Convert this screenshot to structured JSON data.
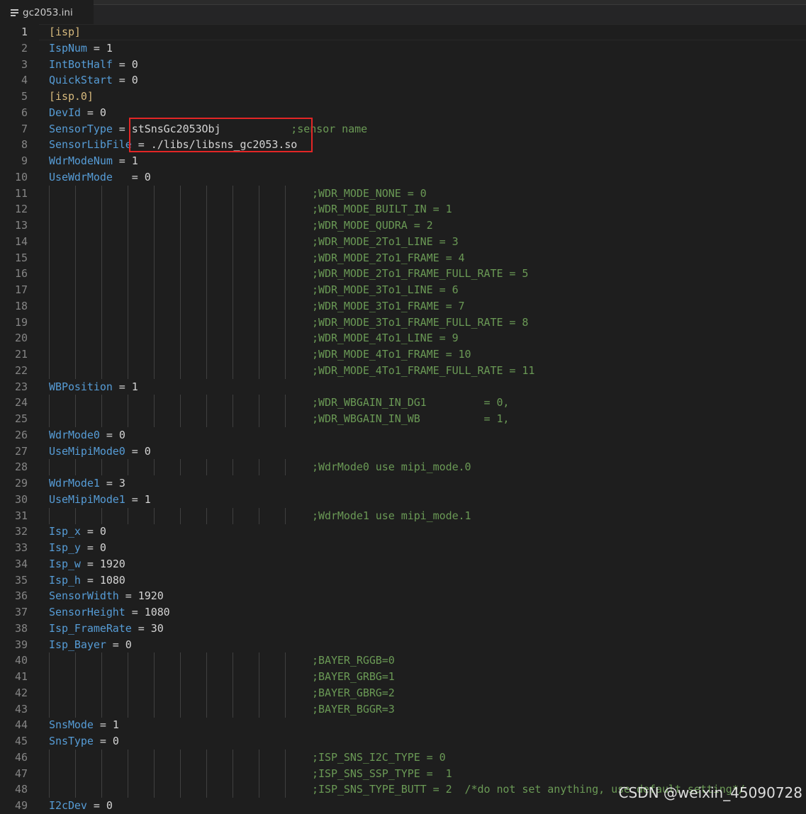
{
  "tab": {
    "filename": "gc2053.ini",
    "icon": "file-lines-icon"
  },
  "lines": [
    {
      "n": "1",
      "parts": [
        {
          "t": "[isp]",
          "c": "sec"
        }
      ],
      "guides": false
    },
    {
      "n": "2",
      "parts": [
        {
          "t": "IspNum",
          "c": "key"
        },
        {
          "t": " = ",
          "c": "eq"
        },
        {
          "t": "1",
          "c": "val"
        }
      ],
      "guides": false
    },
    {
      "n": "3",
      "parts": [
        {
          "t": "IntBotHalf",
          "c": "key"
        },
        {
          "t": " = ",
          "c": "eq"
        },
        {
          "t": "0",
          "c": "val"
        }
      ],
      "guides": false
    },
    {
      "n": "4",
      "parts": [
        {
          "t": "QuickStart",
          "c": "key"
        },
        {
          "t": " = ",
          "c": "eq"
        },
        {
          "t": "0",
          "c": "val"
        }
      ],
      "guides": false
    },
    {
      "n": "5",
      "parts": [
        {
          "t": "[isp.0]",
          "c": "sec"
        }
      ],
      "guides": false
    },
    {
      "n": "6",
      "parts": [
        {
          "t": "DevId",
          "c": "key"
        },
        {
          "t": " = ",
          "c": "eq"
        },
        {
          "t": "0",
          "c": "val"
        }
      ],
      "guides": false
    },
    {
      "n": "7",
      "parts": [
        {
          "t": "SensorType",
          "c": "key"
        },
        {
          "t": " = ",
          "c": "eq"
        },
        {
          "t": "stSnsGc2053Obj           ",
          "c": "val"
        },
        {
          "t": ";sensor name",
          "c": "cmt"
        }
      ],
      "guides": false
    },
    {
      "n": "8",
      "parts": [
        {
          "t": "SensorLibFile",
          "c": "key"
        },
        {
          "t": " = ",
          "c": "eq"
        },
        {
          "t": "./libs/libsns_gc2053.so",
          "c": "val"
        }
      ],
      "guides": false
    },
    {
      "n": "9",
      "parts": [
        {
          "t": "WdrModeNum",
          "c": "key"
        },
        {
          "t": " = ",
          "c": "eq"
        },
        {
          "t": "1",
          "c": "val"
        }
      ],
      "guides": false
    },
    {
      "n": "10",
      "parts": [
        {
          "t": "UseWdrMode",
          "c": "key"
        },
        {
          "t": "   = ",
          "c": "eq"
        },
        {
          "t": "0",
          "c": "val"
        }
      ],
      "guides": false
    },
    {
      "n": "11",
      "parts": [
        {
          "t": ";WDR_MODE_NONE = 0",
          "c": "cmt"
        }
      ],
      "guides": true
    },
    {
      "n": "12",
      "parts": [
        {
          "t": ";WDR_MODE_BUILT_IN = 1",
          "c": "cmt"
        }
      ],
      "guides": true
    },
    {
      "n": "13",
      "parts": [
        {
          "t": ";WDR_MODE_QUDRA = 2",
          "c": "cmt"
        }
      ],
      "guides": true
    },
    {
      "n": "14",
      "parts": [
        {
          "t": ";WDR_MODE_2To1_LINE = 3",
          "c": "cmt"
        }
      ],
      "guides": true
    },
    {
      "n": "15",
      "parts": [
        {
          "t": ";WDR_MODE_2To1_FRAME = 4",
          "c": "cmt"
        }
      ],
      "guides": true
    },
    {
      "n": "16",
      "parts": [
        {
          "t": ";WDR_MODE_2To1_FRAME_FULL_RATE = 5",
          "c": "cmt"
        }
      ],
      "guides": true
    },
    {
      "n": "17",
      "parts": [
        {
          "t": ";WDR_MODE_3To1_LINE = 6",
          "c": "cmt"
        }
      ],
      "guides": true
    },
    {
      "n": "18",
      "parts": [
        {
          "t": ";WDR_MODE_3To1_FRAME = 7",
          "c": "cmt"
        }
      ],
      "guides": true
    },
    {
      "n": "19",
      "parts": [
        {
          "t": ";WDR_MODE_3To1_FRAME_FULL_RATE = 8",
          "c": "cmt"
        }
      ],
      "guides": true
    },
    {
      "n": "20",
      "parts": [
        {
          "t": ";WDR_MODE_4To1_LINE = 9",
          "c": "cmt"
        }
      ],
      "guides": true
    },
    {
      "n": "21",
      "parts": [
        {
          "t": ";WDR_MODE_4To1_FRAME = 10",
          "c": "cmt"
        }
      ],
      "guides": true
    },
    {
      "n": "22",
      "parts": [
        {
          "t": ";WDR_MODE_4To1_FRAME_FULL_RATE = 11",
          "c": "cmt"
        }
      ],
      "guides": true
    },
    {
      "n": "23",
      "parts": [
        {
          "t": "WBPosition",
          "c": "key"
        },
        {
          "t": " = ",
          "c": "eq"
        },
        {
          "t": "1",
          "c": "val"
        }
      ],
      "guides": false
    },
    {
      "n": "24",
      "parts": [
        {
          "t": ";WDR_WBGAIN_IN_DG1         = 0,",
          "c": "cmt"
        }
      ],
      "guides": true
    },
    {
      "n": "25",
      "parts": [
        {
          "t": ";WDR_WBGAIN_IN_WB          = 1,",
          "c": "cmt"
        }
      ],
      "guides": true
    },
    {
      "n": "26",
      "parts": [
        {
          "t": "WdrMode0",
          "c": "key"
        },
        {
          "t": " = ",
          "c": "eq"
        },
        {
          "t": "0",
          "c": "val"
        }
      ],
      "guides": false
    },
    {
      "n": "27",
      "parts": [
        {
          "t": "UseMipiMode0",
          "c": "key"
        },
        {
          "t": " = ",
          "c": "eq"
        },
        {
          "t": "0",
          "c": "val"
        }
      ],
      "guides": false
    },
    {
      "n": "28",
      "parts": [
        {
          "t": ";WdrMode0 use mipi_mode.0",
          "c": "cmt"
        }
      ],
      "guides": true
    },
    {
      "n": "29",
      "parts": [
        {
          "t": "WdrMode1",
          "c": "key"
        },
        {
          "t": " = ",
          "c": "eq"
        },
        {
          "t": "3",
          "c": "val"
        }
      ],
      "guides": false
    },
    {
      "n": "30",
      "parts": [
        {
          "t": "UseMipiMode1",
          "c": "key"
        },
        {
          "t": " = ",
          "c": "eq"
        },
        {
          "t": "1",
          "c": "val"
        }
      ],
      "guides": false
    },
    {
      "n": "31",
      "parts": [
        {
          "t": ";WdrMode1 use mipi_mode.1",
          "c": "cmt"
        }
      ],
      "guides": true
    },
    {
      "n": "32",
      "parts": [
        {
          "t": "Isp_x",
          "c": "key"
        },
        {
          "t": " = ",
          "c": "eq"
        },
        {
          "t": "0",
          "c": "val"
        }
      ],
      "guides": false
    },
    {
      "n": "33",
      "parts": [
        {
          "t": "Isp_y",
          "c": "key"
        },
        {
          "t": " = ",
          "c": "eq"
        },
        {
          "t": "0",
          "c": "val"
        }
      ],
      "guides": false
    },
    {
      "n": "34",
      "parts": [
        {
          "t": "Isp_w",
          "c": "key"
        },
        {
          "t": " = ",
          "c": "eq"
        },
        {
          "t": "1920",
          "c": "val"
        }
      ],
      "guides": false
    },
    {
      "n": "35",
      "parts": [
        {
          "t": "Isp_h",
          "c": "key"
        },
        {
          "t": " = ",
          "c": "eq"
        },
        {
          "t": "1080",
          "c": "val"
        }
      ],
      "guides": false
    },
    {
      "n": "36",
      "parts": [
        {
          "t": "SensorWidth",
          "c": "key"
        },
        {
          "t": " = ",
          "c": "eq"
        },
        {
          "t": "1920",
          "c": "val"
        }
      ],
      "guides": false
    },
    {
      "n": "37",
      "parts": [
        {
          "t": "SensorHeight",
          "c": "key"
        },
        {
          "t": " = ",
          "c": "eq"
        },
        {
          "t": "1080",
          "c": "val"
        }
      ],
      "guides": false
    },
    {
      "n": "38",
      "parts": [
        {
          "t": "Isp_FrameRate",
          "c": "key"
        },
        {
          "t": " = ",
          "c": "eq"
        },
        {
          "t": "30",
          "c": "val"
        }
      ],
      "guides": false
    },
    {
      "n": "39",
      "parts": [
        {
          "t": "Isp_Bayer",
          "c": "key"
        },
        {
          "t": " = ",
          "c": "eq"
        },
        {
          "t": "0",
          "c": "val"
        }
      ],
      "guides": false
    },
    {
      "n": "40",
      "parts": [
        {
          "t": ";BAYER_RGGB=0",
          "c": "cmt"
        }
      ],
      "guides": true
    },
    {
      "n": "41",
      "parts": [
        {
          "t": ";BAYER_GRBG=1",
          "c": "cmt"
        }
      ],
      "guides": true
    },
    {
      "n": "42",
      "parts": [
        {
          "t": ";BAYER_GBRG=2",
          "c": "cmt"
        }
      ],
      "guides": true
    },
    {
      "n": "43",
      "parts": [
        {
          "t": ";BAYER_BGGR=3",
          "c": "cmt"
        }
      ],
      "guides": true
    },
    {
      "n": "44",
      "parts": [
        {
          "t": "SnsMode",
          "c": "key"
        },
        {
          "t": " = ",
          "c": "eq"
        },
        {
          "t": "1",
          "c": "val"
        }
      ],
      "guides": false
    },
    {
      "n": "45",
      "parts": [
        {
          "t": "SnsType",
          "c": "key"
        },
        {
          "t": " = ",
          "c": "eq"
        },
        {
          "t": "0",
          "c": "val"
        }
      ],
      "guides": false
    },
    {
      "n": "46",
      "parts": [
        {
          "t": ";ISP_SNS_I2C_TYPE = 0",
          "c": "cmt"
        }
      ],
      "guides": true
    },
    {
      "n": "47",
      "parts": [
        {
          "t": ";ISP_SNS_SSP_TYPE =  1",
          "c": "cmt"
        }
      ],
      "guides": true
    },
    {
      "n": "48",
      "parts": [
        {
          "t": ";ISP_SNS_TYPE_BUTT = 2  /*do not set anything, use default setting*/",
          "c": "cmt"
        }
      ],
      "guides": true
    },
    {
      "n": "49",
      "parts": [
        {
          "t": "I2cDev",
          "c": "key"
        },
        {
          "t": " = ",
          "c": "eq"
        },
        {
          "t": "0",
          "c": "val"
        }
      ],
      "guides": false
    }
  ],
  "current_line": "1",
  "watermark": "CSDN @weixin_45090728",
  "colors": {
    "background": "#1e1e1e",
    "key": "#569cd6",
    "section": "#d7ba7d",
    "comment": "#6a9955",
    "value": "#d4d4d4",
    "highlight_box": "#e32626"
  }
}
